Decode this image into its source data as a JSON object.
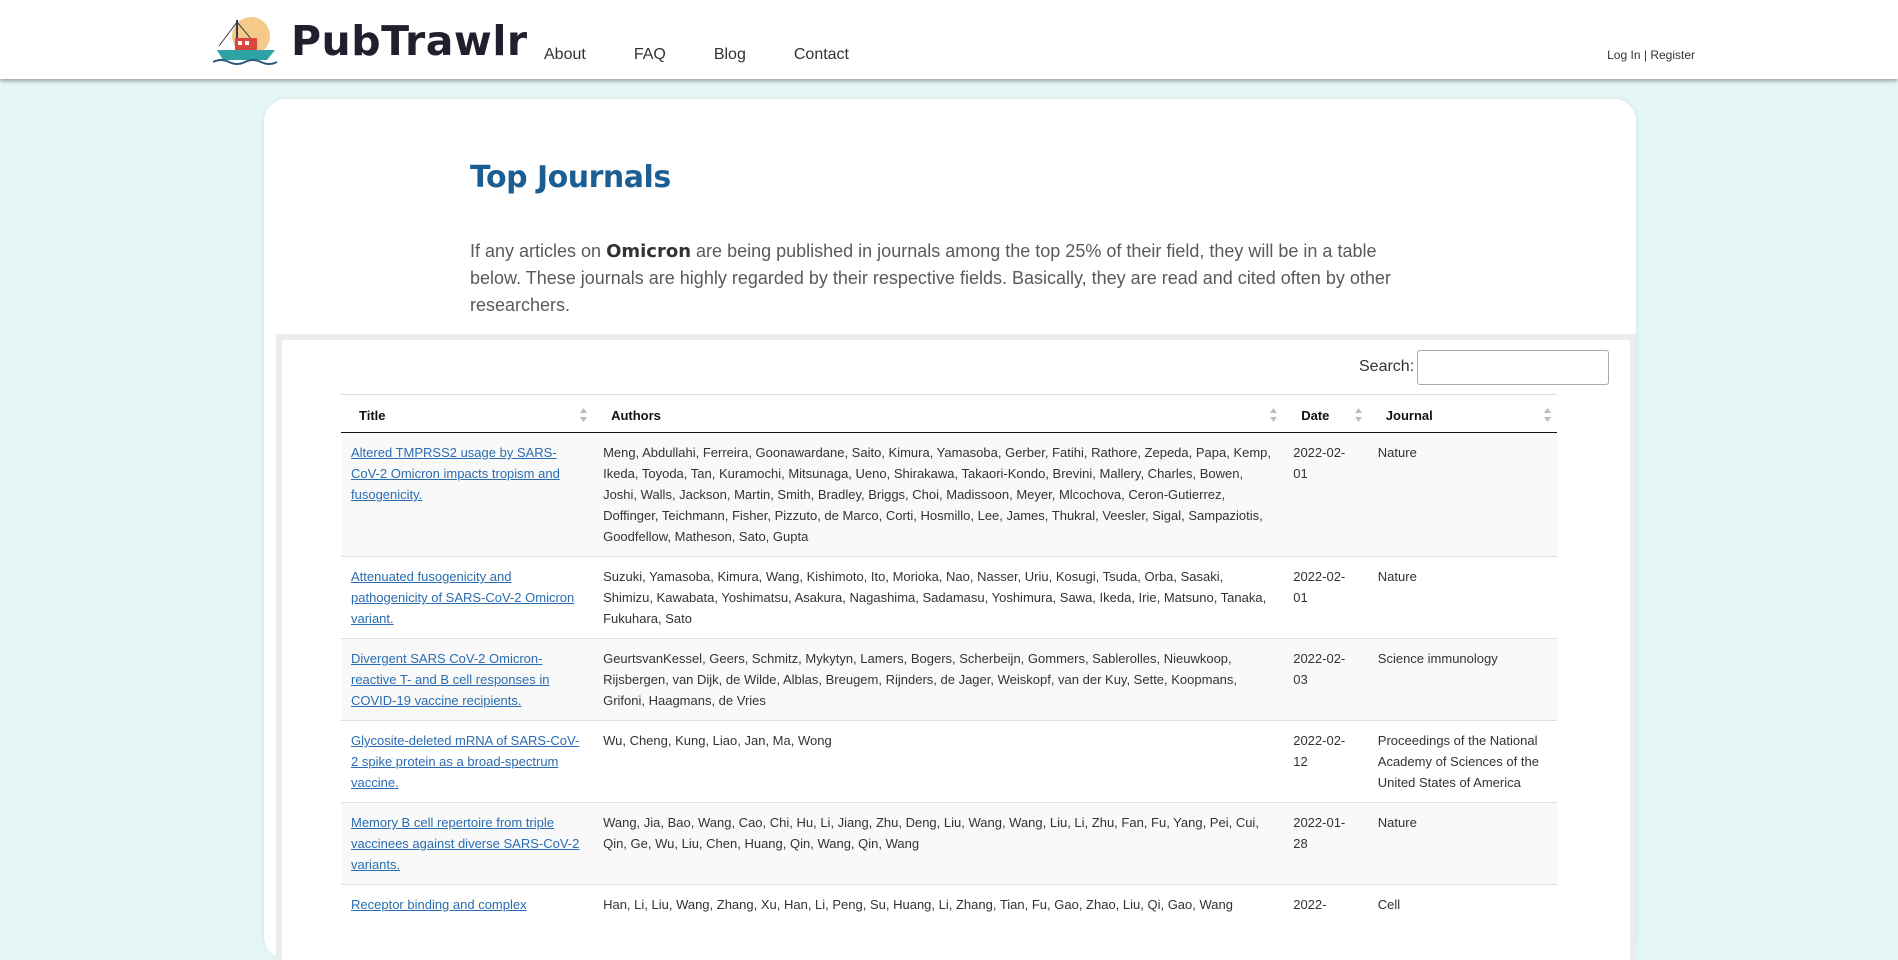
{
  "header": {
    "logo_text": "PubTrawlr",
    "nav": [
      "About",
      "FAQ",
      "Blog",
      "Contact"
    ],
    "login": "Log In",
    "separator": "|",
    "register": "Register"
  },
  "page": {
    "title": "Top Journals",
    "intro_before": "If any articles on ",
    "topic": "Omicron",
    "intro_after": " are being published in journals among the top 25% of their field, they will be in a table below. These journals are highly regarded by their respective fields. Basically, they are read and cited often by other researchers."
  },
  "search": {
    "label": "Search:",
    "value": ""
  },
  "table": {
    "columns": [
      "Title",
      "Authors",
      "Date",
      "Journal"
    ],
    "rows": [
      {
        "title": "Altered TMPRSS2 usage by SARS-CoV-2 Omicron impacts tropism and fusogenicity.",
        "authors": "Meng, Abdullahi, Ferreira, Goonawardane, Saito, Kimura, Yamasoba, Gerber, Fatihi, Rathore, Zepeda, Papa, Kemp, Ikeda, Toyoda, Tan, Kuramochi, Mitsunaga, Ueno, Shirakawa, Takaori-Kondo, Brevini, Mallery, Charles, Bowen, Joshi, Walls, Jackson, Martin, Smith, Bradley, Briggs, Choi, Madissoon, Meyer, Mlcochova, Ceron-Gutierrez, Doffinger, Teichmann, Fisher, Pizzuto, de Marco, Corti, Hosmillo, Lee, James, Thukral, Veesler, Sigal, Sampaziotis, Goodfellow, Matheson, Sato, Gupta",
        "date": "2022-02-01",
        "journal": "Nature"
      },
      {
        "title": "Attenuated fusogenicity and pathogenicity of SARS-CoV-2 Omicron variant.",
        "authors": "Suzuki, Yamasoba, Kimura, Wang, Kishimoto, Ito, Morioka, Nao, Nasser, Uriu, Kosugi, Tsuda, Orba, Sasaki, Shimizu, Kawabata, Yoshimatsu, Asakura, Nagashima, Sadamasu, Yoshimura, Sawa, Ikeda, Irie, Matsuno, Tanaka, Fukuhara, Sato",
        "date": "2022-02-01",
        "journal": "Nature"
      },
      {
        "title": "Divergent SARS CoV-2 Omicron-reactive T- and B cell responses in COVID-19 vaccine recipients.",
        "authors": "GeurtsvanKessel, Geers, Schmitz, Mykytyn, Lamers, Bogers, Scherbeijn, Gommers, Sablerolles, Nieuwkoop, Rijsbergen, van Dijk, de Wilde, Alblas, Breugem, Rijnders, de Jager, Weiskopf, van der Kuy, Sette, Koopmans, Grifoni, Haagmans, de Vries",
        "date": "2022-02-03",
        "journal": "Science immunology"
      },
      {
        "title": "Glycosite-deleted mRNA of SARS-CoV-2 spike protein as a broad-spectrum vaccine.",
        "authors": "Wu, Cheng, Kung, Liao, Jan, Ma, Wong",
        "date": "2022-02-12",
        "journal": "Proceedings of the National Academy of Sciences of the United States of America"
      },
      {
        "title": "Memory B cell repertoire from triple vaccinees against diverse SARS-CoV-2 variants.",
        "authors": "Wang, Jia, Bao, Wang, Cao, Chi, Hu, Li, Jiang, Zhu, Deng, Liu, Wang, Wang, Liu, Li, Zhu, Fan, Fu, Yang, Pei, Cui, Qin, Ge, Wu, Liu, Chen, Huang, Qin, Wang, Qin, Wang",
        "date": "2022-01-28",
        "journal": "Nature"
      },
      {
        "title": "Receptor binding and complex",
        "authors": "Han, Li, Liu, Wang, Zhang, Xu, Han, Li, Peng, Su, Huang, Li, Zhang, Tian, Fu, Gao, Zhao, Liu, Qi, Gao, Wang",
        "date": "2022-",
        "journal": "Cell"
      }
    ]
  }
}
